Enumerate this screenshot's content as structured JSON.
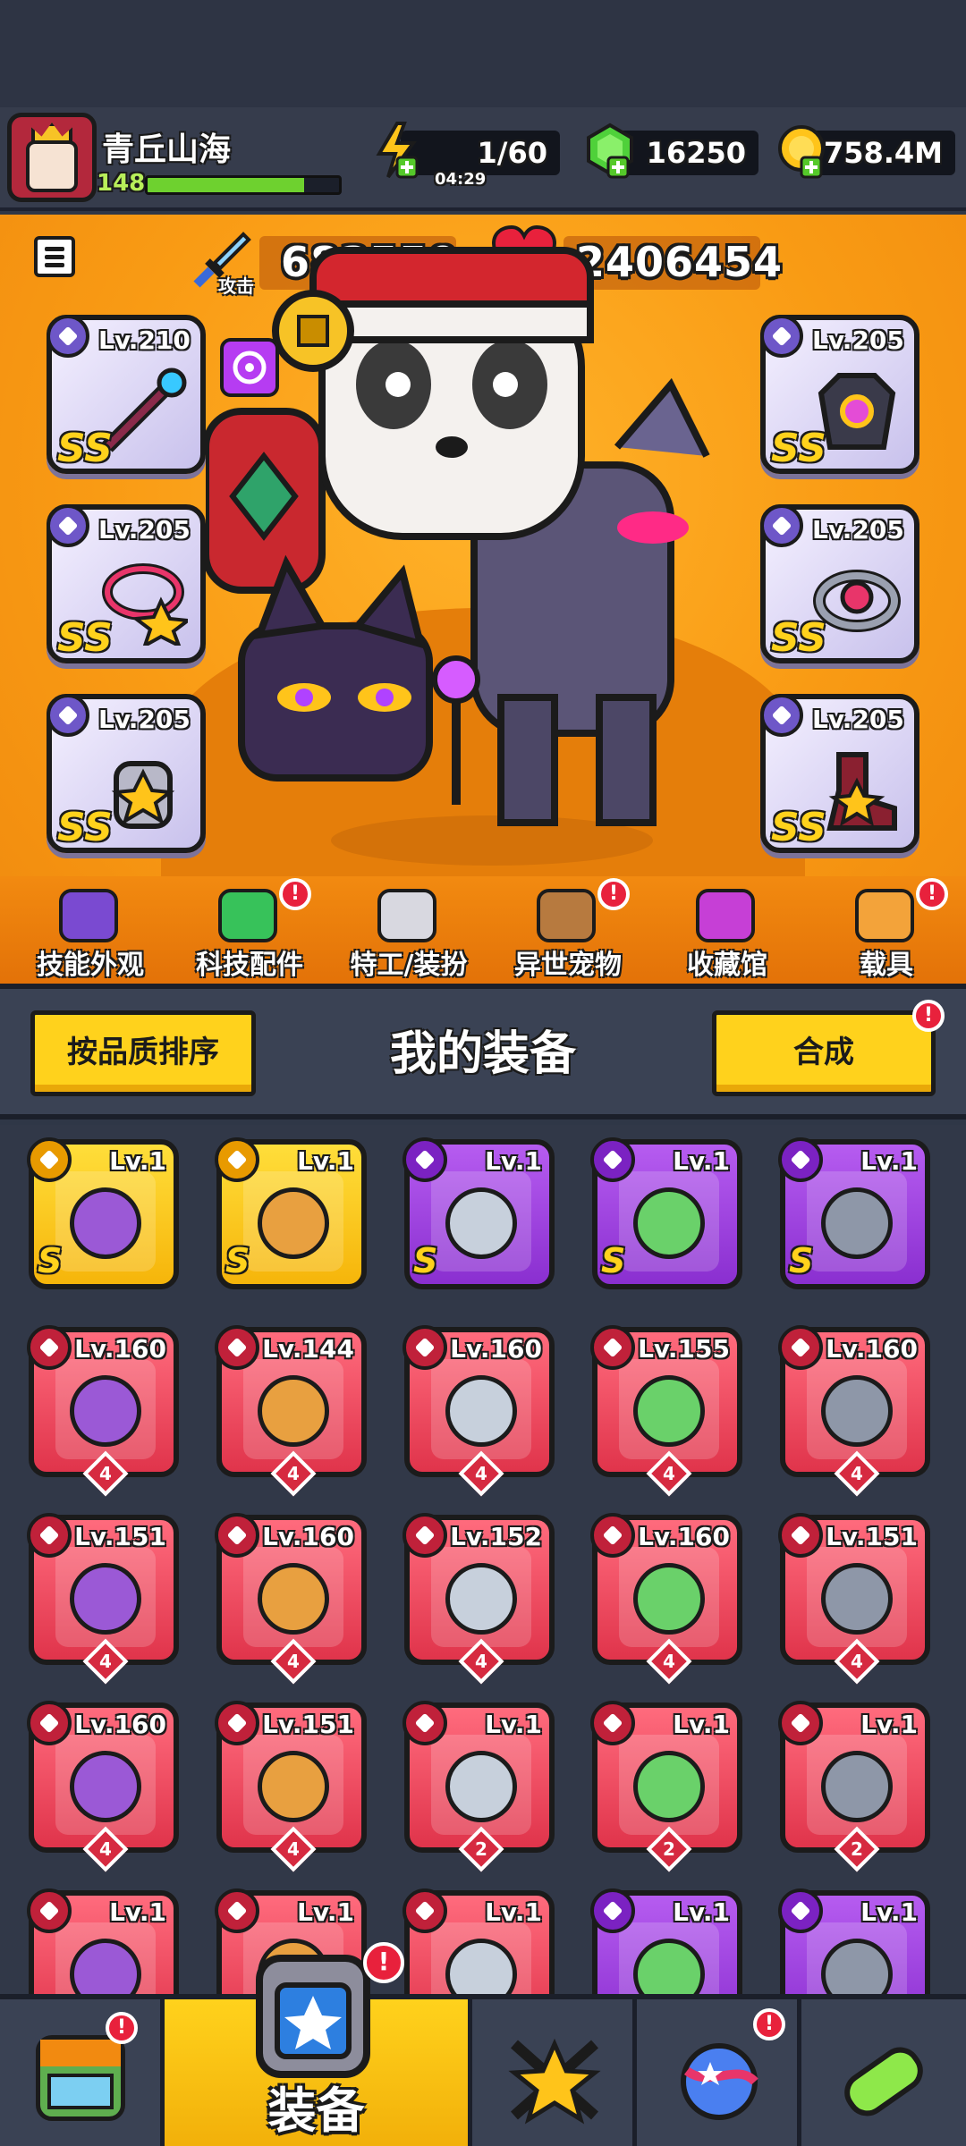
{
  "player": {
    "name": "青丘山海",
    "level": "148",
    "xp_fraction": 0.82
  },
  "resources": {
    "energy": "1/60",
    "energy_timer": "04:29",
    "gems": "16250",
    "gold": "758.4M"
  },
  "stats": {
    "attack_label": "攻击",
    "attack_value": "683550",
    "life_label": "生命",
    "life_value": "2406454"
  },
  "equipped_slots": [
    {
      "level": "Lv.210",
      "grade": "SS"
    },
    {
      "level": "Lv.205",
      "grade": "SS"
    },
    {
      "level": "Lv.205",
      "grade": "SS"
    },
    {
      "level": "Lv.205",
      "grade": "SS"
    },
    {
      "level": "Lv.205",
      "grade": "SS"
    },
    {
      "level": "Lv.205",
      "grade": "SS"
    }
  ],
  "features": [
    {
      "label": "技能外观",
      "badge": false,
      "icon": "skill-skin-icon",
      "color": "#7a4ad1"
    },
    {
      "label": "科技配件",
      "badge": true,
      "icon": "tech-parts-icon",
      "color": "#37c25a"
    },
    {
      "label": "特工/装扮",
      "badge": false,
      "icon": "agent-icon",
      "color": "#d8d8e0"
    },
    {
      "label": "异世宠物",
      "badge": true,
      "icon": "pet-icon",
      "color": "#b77a3f"
    },
    {
      "label": "收藏馆",
      "badge": false,
      "icon": "collection-icon",
      "color": "#c63fd6"
    },
    {
      "label": "载具",
      "badge": true,
      "icon": "vehicle-icon",
      "color": "#f3a33a"
    }
  ],
  "equipment": {
    "sort_button": "按品质排序",
    "title": "我的装备",
    "merge_button": "合成",
    "badge": "!"
  },
  "items": [
    {
      "level": "Lv.1",
      "rarity": "gold",
      "grade": "S",
      "stars": ""
    },
    {
      "level": "Lv.1",
      "rarity": "gold",
      "grade": "S",
      "stars": ""
    },
    {
      "level": "Lv.1",
      "rarity": "purple",
      "grade": "S",
      "stars": ""
    },
    {
      "level": "Lv.1",
      "rarity": "purple",
      "grade": "S",
      "stars": ""
    },
    {
      "level": "Lv.1",
      "rarity": "purple",
      "grade": "S",
      "stars": ""
    },
    {
      "level": "Lv.160",
      "rarity": "red",
      "grade": "",
      "stars": "4"
    },
    {
      "level": "Lv.144",
      "rarity": "red",
      "grade": "",
      "stars": "4"
    },
    {
      "level": "Lv.160",
      "rarity": "red",
      "grade": "",
      "stars": "4"
    },
    {
      "level": "Lv.155",
      "rarity": "red",
      "grade": "",
      "stars": "4"
    },
    {
      "level": "Lv.160",
      "rarity": "red",
      "grade": "",
      "stars": "4"
    },
    {
      "level": "Lv.151",
      "rarity": "red",
      "grade": "",
      "stars": "4"
    },
    {
      "level": "Lv.160",
      "rarity": "red",
      "grade": "",
      "stars": "4"
    },
    {
      "level": "Lv.152",
      "rarity": "red",
      "grade": "",
      "stars": "4"
    },
    {
      "level": "Lv.160",
      "rarity": "red",
      "grade": "",
      "stars": "4"
    },
    {
      "level": "Lv.151",
      "rarity": "red",
      "grade": "",
      "stars": "4"
    },
    {
      "level": "Lv.160",
      "rarity": "red",
      "grade": "",
      "stars": "4"
    },
    {
      "level": "Lv.151",
      "rarity": "red",
      "grade": "",
      "stars": "4"
    },
    {
      "level": "Lv.1",
      "rarity": "red",
      "grade": "",
      "stars": "2"
    },
    {
      "level": "Lv.1",
      "rarity": "red",
      "grade": "",
      "stars": "2"
    },
    {
      "level": "Lv.1",
      "rarity": "red",
      "grade": "",
      "stars": "2"
    },
    {
      "level": "Lv.1",
      "rarity": "red",
      "grade": "",
      "stars": ""
    },
    {
      "level": "Lv.1",
      "rarity": "red",
      "grade": "",
      "stars": ""
    },
    {
      "level": "Lv.1",
      "rarity": "red",
      "grade": "",
      "stars": ""
    },
    {
      "level": "Lv.1",
      "rarity": "purple",
      "grade": "",
      "stars": ""
    },
    {
      "level": "Lv.1",
      "rarity": "purple",
      "grade": "",
      "stars": ""
    }
  ],
  "nav": {
    "shop_icon": "shop-icon",
    "equip_label": "装备",
    "battle_icon": "battle-star-icon",
    "world_icon": "planet-icon",
    "lab_icon": "lab-capsule-icon"
  }
}
